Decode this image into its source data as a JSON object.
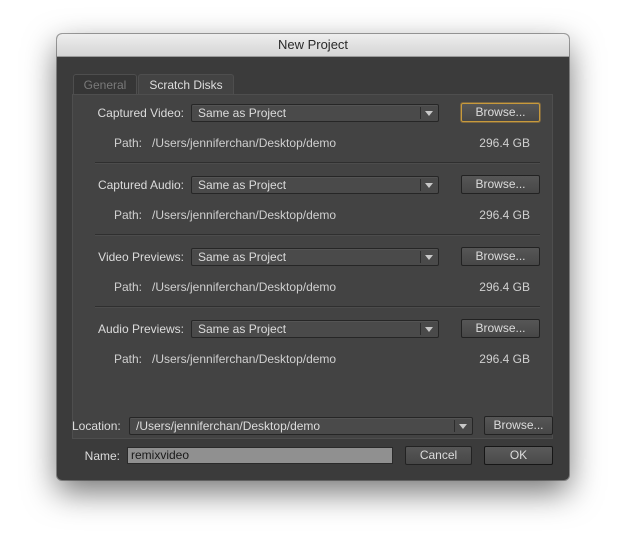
{
  "dialog": {
    "title": "New Project"
  },
  "tabs": [
    {
      "label": "General"
    },
    {
      "label": "Scratch Disks"
    }
  ],
  "sections": [
    {
      "label": "Captured Video:",
      "value": "Same as Project",
      "browse": "Browse...",
      "path_label": "Path:",
      "path": "/Users/jenniferchan/Desktop/demo",
      "size": "296.4 GB"
    },
    {
      "label": "Captured Audio:",
      "value": "Same as Project",
      "browse": "Browse...",
      "path_label": "Path:",
      "path": "/Users/jenniferchan/Desktop/demo",
      "size": "296.4 GB"
    },
    {
      "label": "Video Previews:",
      "value": "Same as Project",
      "browse": "Browse...",
      "path_label": "Path:",
      "path": "/Users/jenniferchan/Desktop/demo",
      "size": "296.4 GB"
    },
    {
      "label": "Audio Previews:",
      "value": "Same as Project",
      "browse": "Browse...",
      "path_label": "Path:",
      "path": "/Users/jenniferchan/Desktop/demo",
      "size": "296.4 GB"
    }
  ],
  "location": {
    "label": "Location:",
    "value": "/Users/jenniferchan/Desktop/demo",
    "browse": "Browse..."
  },
  "name": {
    "label": "Name:",
    "value": "remixvideo"
  },
  "buttons": {
    "cancel": "Cancel",
    "ok": "OK"
  },
  "colors": {
    "dialog_bg": "#3b3b3b",
    "focus_ring": "#c89a3c"
  }
}
